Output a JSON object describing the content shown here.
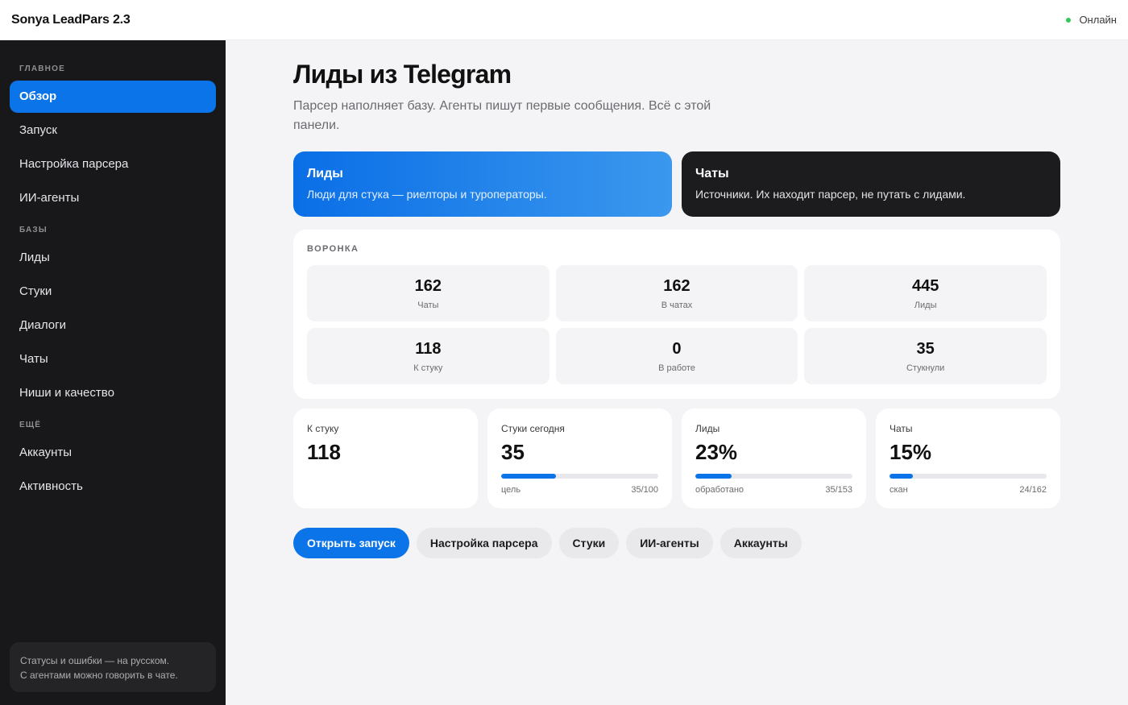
{
  "app": {
    "title": "Sonya LeadPars 2.3",
    "status": "Онлайн",
    "status_color": "#34c759"
  },
  "sidebar": {
    "sections": [
      {
        "title": "ГЛАВНОЕ",
        "items": [
          "Обзор",
          "Запуск",
          "Настройка парсера",
          "ИИ-агенты"
        ]
      },
      {
        "title": "БАЗЫ",
        "items": [
          "Лиды",
          "Стуки",
          "Диалоги",
          "Чаты",
          "Ниши и качество"
        ]
      },
      {
        "title": "ЕЩЁ",
        "items": [
          "Аккаунты",
          "Активность"
        ]
      }
    ],
    "active_item": "Обзор",
    "note_line1": "Статусы и ошибки — на русском.",
    "note_line2": "С агентами можно говорить в чате."
  },
  "page": {
    "title": "Лиды из Telegram",
    "subtitle": "Парсер наполняет базу. Агенты пишут первые сообщения. Всё с этой панели."
  },
  "hero": [
    {
      "title": "Лиды",
      "desc": "Люди для стука — риелторы и туроператоры."
    },
    {
      "title": "Чаты",
      "desc": "Источники. Их находит парсер, не путать с лидами."
    }
  ],
  "funnel": {
    "label": "ВОРОНКА",
    "cells": [
      {
        "value": "162",
        "caption": "Чаты"
      },
      {
        "value": "162",
        "caption": "В чатах"
      },
      {
        "value": "445",
        "caption": "Лиды"
      },
      {
        "value": "118",
        "caption": "К стуку"
      },
      {
        "value": "0",
        "caption": "В работе"
      },
      {
        "value": "35",
        "caption": "Стукнули"
      }
    ]
  },
  "stats": [
    {
      "label": "К стуку",
      "value": "118"
    },
    {
      "label": "Стуки сегодня",
      "value": "35",
      "progress": 0.35,
      "meta_left": "цель",
      "meta_right": "35/100"
    },
    {
      "label": "Лиды",
      "value": "23%",
      "progress": 0.23,
      "meta_left": "обработано",
      "meta_right": "35/153"
    },
    {
      "label": "Чаты",
      "value": "15%",
      "progress": 0.15,
      "meta_left": "скан",
      "meta_right": "24/162"
    }
  ],
  "actions": [
    "Открыть запуск",
    "Настройка парсера",
    "Стуки",
    "ИИ-агенты",
    "Аккаунты"
  ],
  "colors": {
    "accent": "#0a74e8",
    "sidebar_bg": "#18181a"
  }
}
